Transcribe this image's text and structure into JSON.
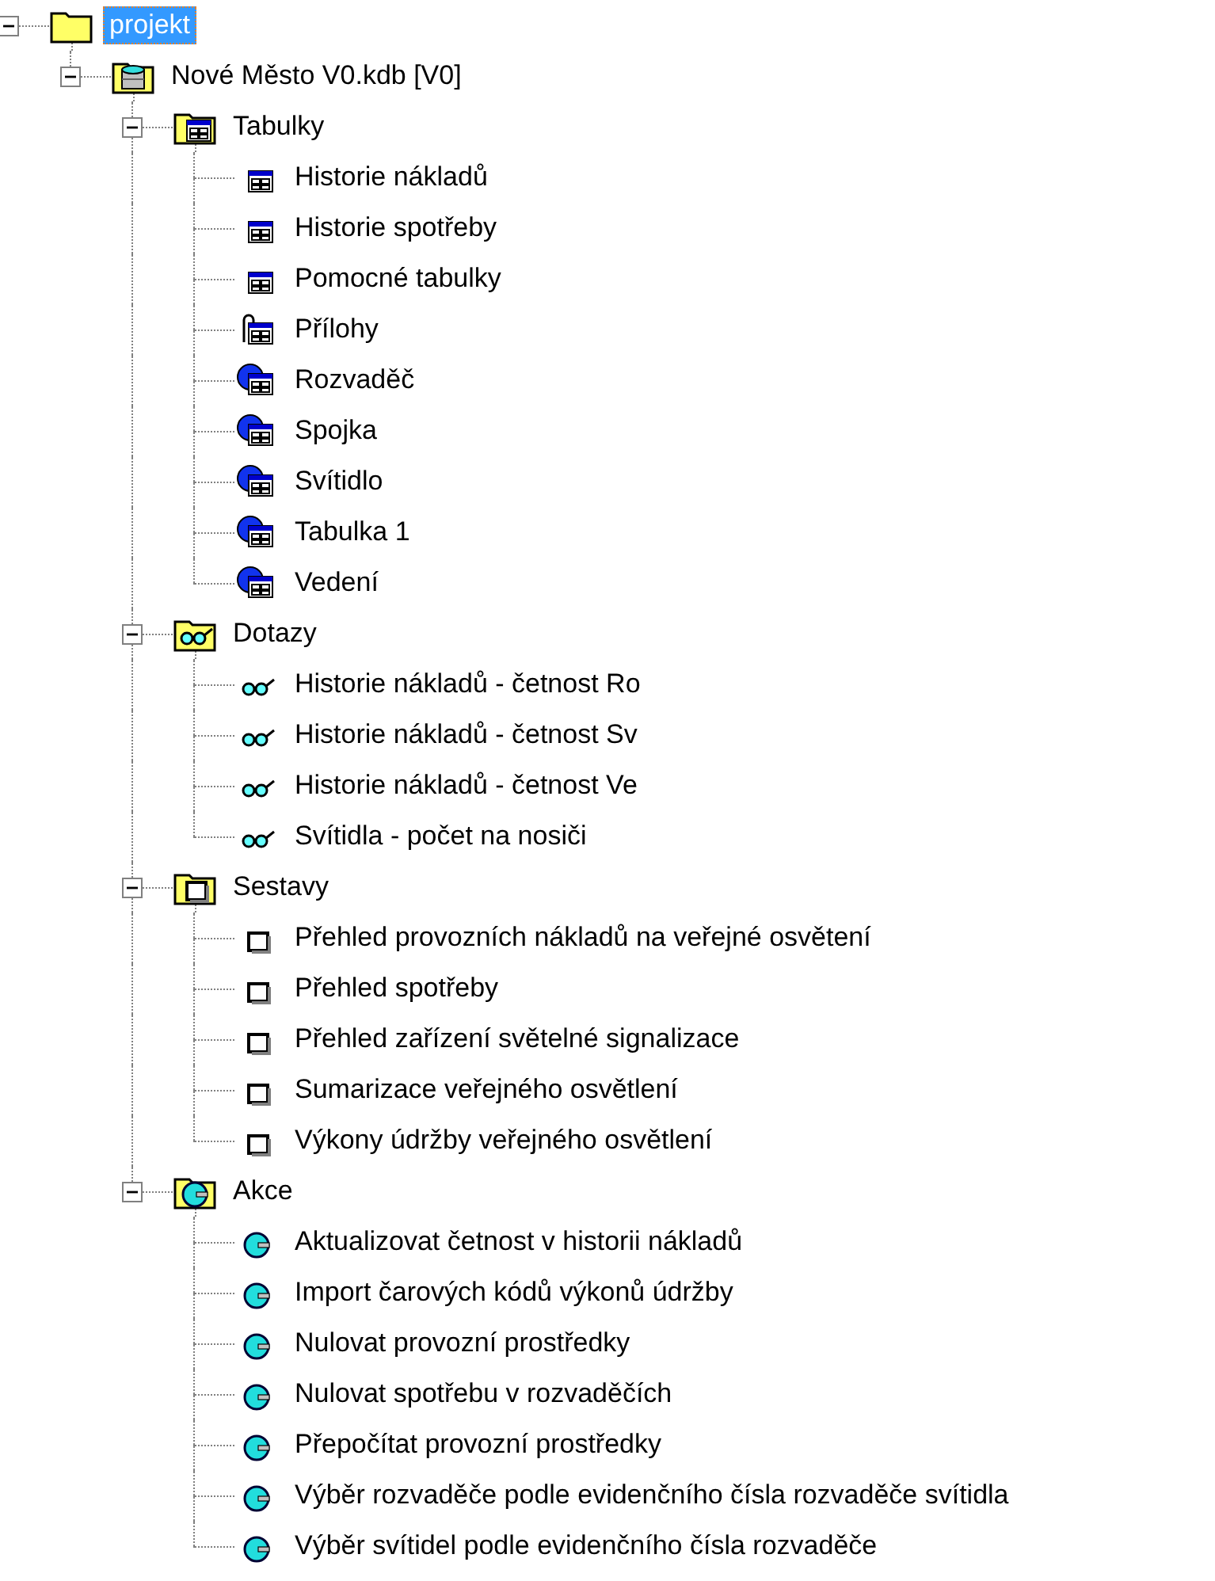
{
  "tree": [
    {
      "label": "projekt",
      "kind": "folder",
      "selected": true,
      "expanded": true,
      "children": [
        {
          "label": "Nové Město V0.kdb [V0]",
          "kind": "database",
          "selected": false,
          "expanded": true,
          "children": [
            {
              "label": "Tabulky",
              "kind": "table-group",
              "selected": false,
              "expanded": true,
              "children": [
                {
                  "label": "Historie nákladů",
                  "kind": "table",
                  "selected": false
                },
                {
                  "label": "Historie spotřeby",
                  "kind": "table",
                  "selected": false
                },
                {
                  "label": "Pomocné tabulky",
                  "kind": "table",
                  "selected": false
                },
                {
                  "label": "Přílohy",
                  "kind": "attached-table",
                  "selected": false
                },
                {
                  "label": "Rozvaděč",
                  "kind": "linked-table",
                  "selected": false
                },
                {
                  "label": "Spojka",
                  "kind": "linked-table",
                  "selected": false
                },
                {
                  "label": "Svítidlo",
                  "kind": "linked-table",
                  "selected": false
                },
                {
                  "label": "Tabulka 1",
                  "kind": "linked-table",
                  "selected": false
                },
                {
                  "label": "Vedení",
                  "kind": "linked-table",
                  "selected": false
                }
              ]
            },
            {
              "label": "Dotazy",
              "kind": "query-group",
              "selected": false,
              "expanded": true,
              "children": [
                {
                  "label": "Historie nákladů - četnost Ro",
                  "kind": "query",
                  "selected": false
                },
                {
                  "label": "Historie nákladů - četnost Sv",
                  "kind": "query",
                  "selected": false
                },
                {
                  "label": "Historie nákladů - četnost Ve",
                  "kind": "query",
                  "selected": false
                },
                {
                  "label": "Svítidla - počet na nosiči",
                  "kind": "query",
                  "selected": false
                }
              ]
            },
            {
              "label": "Sestavy",
              "kind": "report-group",
              "selected": false,
              "expanded": true,
              "children": [
                {
                  "label": "Přehled provozních nákladů na veřejné osvětení",
                  "kind": "report",
                  "selected": false
                },
                {
                  "label": "Přehled spotřeby",
                  "kind": "report",
                  "selected": false
                },
                {
                  "label": "Přehled zařízení světelné signalizace",
                  "kind": "report",
                  "selected": false
                },
                {
                  "label": "Sumarizace veřejného osvětlení",
                  "kind": "report",
                  "selected": false
                },
                {
                  "label": "Výkony údržby veřejného osvětlení",
                  "kind": "report",
                  "selected": false
                }
              ]
            },
            {
              "label": "Akce",
              "kind": "action-group",
              "selected": false,
              "expanded": true,
              "children": [
                {
                  "label": "Aktualizovat četnost v historii nákladů",
                  "kind": "action",
                  "selected": false
                },
                {
                  "label": "Import čarových kódů výkonů údržby",
                  "kind": "action",
                  "selected": false
                },
                {
                  "label": "Nulovat provozní prostředky",
                  "kind": "action",
                  "selected": false
                },
                {
                  "label": "Nulovat spotřebu v rozvaděčích",
                  "kind": "action",
                  "selected": false
                },
                {
                  "label": "Přepočítat provozní prostředky",
                  "kind": "action",
                  "selected": false
                },
                {
                  "label": "Výběr rozvaděče podle evidenčního čísla rozvaděče svítidla",
                  "kind": "action",
                  "selected": false
                },
                {
                  "label": "Výběr svítidel podle evidenčního čísla rozvaděče",
                  "kind": "action",
                  "selected": false
                }
              ]
            }
          ]
        }
      ]
    }
  ]
}
